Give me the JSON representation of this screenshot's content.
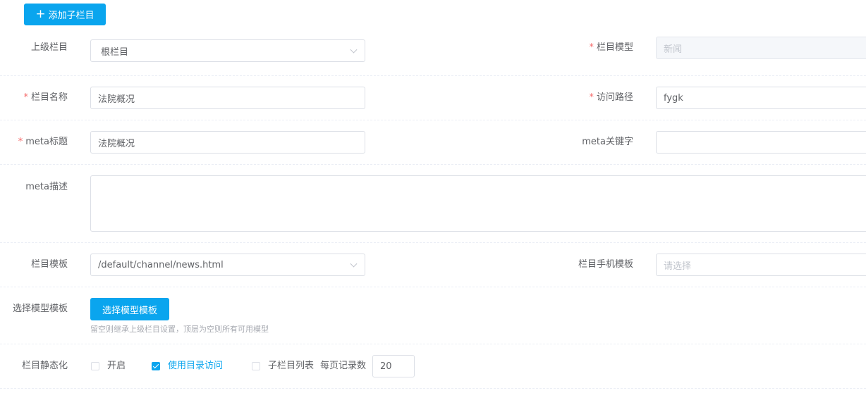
{
  "toolbar": {
    "add_sub_label": "添加子栏目"
  },
  "form": {
    "parent": {
      "label": "上级栏目",
      "value": "根栏目"
    },
    "model": {
      "label": "栏目模型",
      "value": "新闻"
    },
    "name": {
      "label": "栏目名称",
      "value": "法院概况"
    },
    "path": {
      "label": "访问路径",
      "value": "fygk"
    },
    "meta_title": {
      "label": "meta标题",
      "value": "法院概况"
    },
    "meta_keywords": {
      "label": "meta关键字",
      "value": ""
    },
    "meta_desc": {
      "label": "meta描述",
      "value": ""
    },
    "template": {
      "label": "栏目模板",
      "value": "/default/channel/news.html"
    },
    "mobile_template": {
      "label": "栏目手机模板",
      "placeholder": "请选择"
    },
    "model_template": {
      "label": "选择模型模板",
      "button_label": "选择模型模板",
      "hint": "留空则继承上级栏目设置，顶层为空则所有可用模型"
    },
    "static": {
      "label": "栏目静态化",
      "enable": {
        "label": "开启",
        "checked": false
      },
      "dir_access": {
        "label": "使用目录访问",
        "checked": true
      },
      "sub_list": {
        "label": "子栏目列表",
        "checked": false
      },
      "per_page_label": "每页记录数",
      "per_page_value": "20"
    }
  },
  "required_mark": "*"
}
